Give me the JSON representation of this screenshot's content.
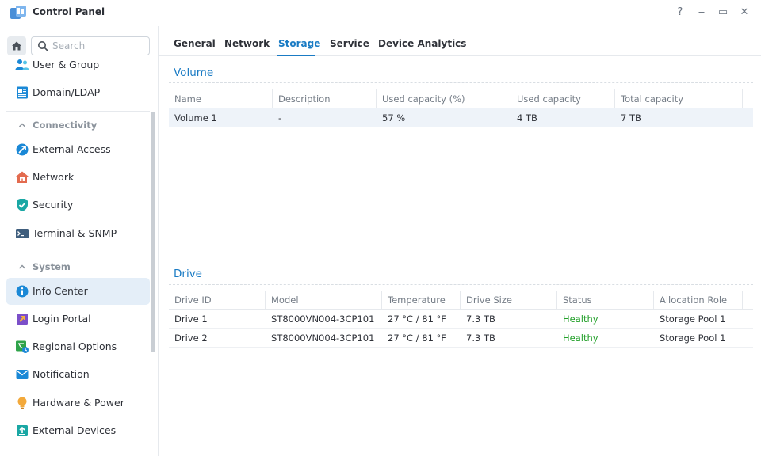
{
  "window": {
    "title": "Control Panel",
    "controls": {
      "help": "?",
      "minimize": "‒",
      "maximize": "▭",
      "close": "✕"
    }
  },
  "search": {
    "placeholder": "Search"
  },
  "sidebar": {
    "items_top": [
      {
        "label": "User & Group",
        "icon": "users-icon"
      },
      {
        "label": "Domain/LDAP",
        "icon": "domain-icon"
      }
    ],
    "sections": [
      {
        "title": "Connectivity",
        "items": [
          {
            "label": "External Access",
            "icon": "external-access-icon"
          },
          {
            "label": "Network",
            "icon": "network-house-icon"
          },
          {
            "label": "Security",
            "icon": "shield-icon"
          },
          {
            "label": "Terminal & SNMP",
            "icon": "terminal-icon"
          }
        ]
      },
      {
        "title": "System",
        "items": [
          {
            "label": "Info Center",
            "icon": "info-icon",
            "active": true
          },
          {
            "label": "Login Portal",
            "icon": "login-portal-icon"
          },
          {
            "label": "Regional Options",
            "icon": "regional-icon"
          },
          {
            "label": "Notification",
            "icon": "notification-icon"
          },
          {
            "label": "Hardware & Power",
            "icon": "bulb-icon"
          },
          {
            "label": "External Devices",
            "icon": "external-device-icon"
          }
        ]
      }
    ]
  },
  "tabs": [
    {
      "label": "General"
    },
    {
      "label": "Network"
    },
    {
      "label": "Storage",
      "active": true
    },
    {
      "label": "Service"
    },
    {
      "label": "Device Analytics"
    }
  ],
  "volume": {
    "title": "Volume",
    "columns": [
      "Name",
      "Description",
      "Used capacity (%)",
      "Used capacity",
      "Total capacity"
    ],
    "rows": [
      [
        "Volume 1",
        "-",
        "57 %",
        "4 TB",
        "7 TB"
      ]
    ]
  },
  "drive": {
    "title": "Drive",
    "columns": [
      "Drive ID",
      "Model",
      "Temperature",
      "Drive Size",
      "Status",
      "Allocation Role"
    ],
    "rows": [
      [
        "Drive 1",
        "ST8000VN004-3CP101",
        "27 °C / 81 °F",
        "7.3 TB",
        "Healthy",
        "Storage Pool 1"
      ],
      [
        "Drive 2",
        "ST8000VN004-3CP101",
        "27 °C / 81 °F",
        "7.3 TB",
        "Healthy",
        "Storage Pool 1"
      ]
    ]
  },
  "colors": {
    "accent": "#1a7bc4",
    "healthy": "#23a02a",
    "selected_row": "#eef3f9",
    "active_nav": "#e4eef8"
  }
}
